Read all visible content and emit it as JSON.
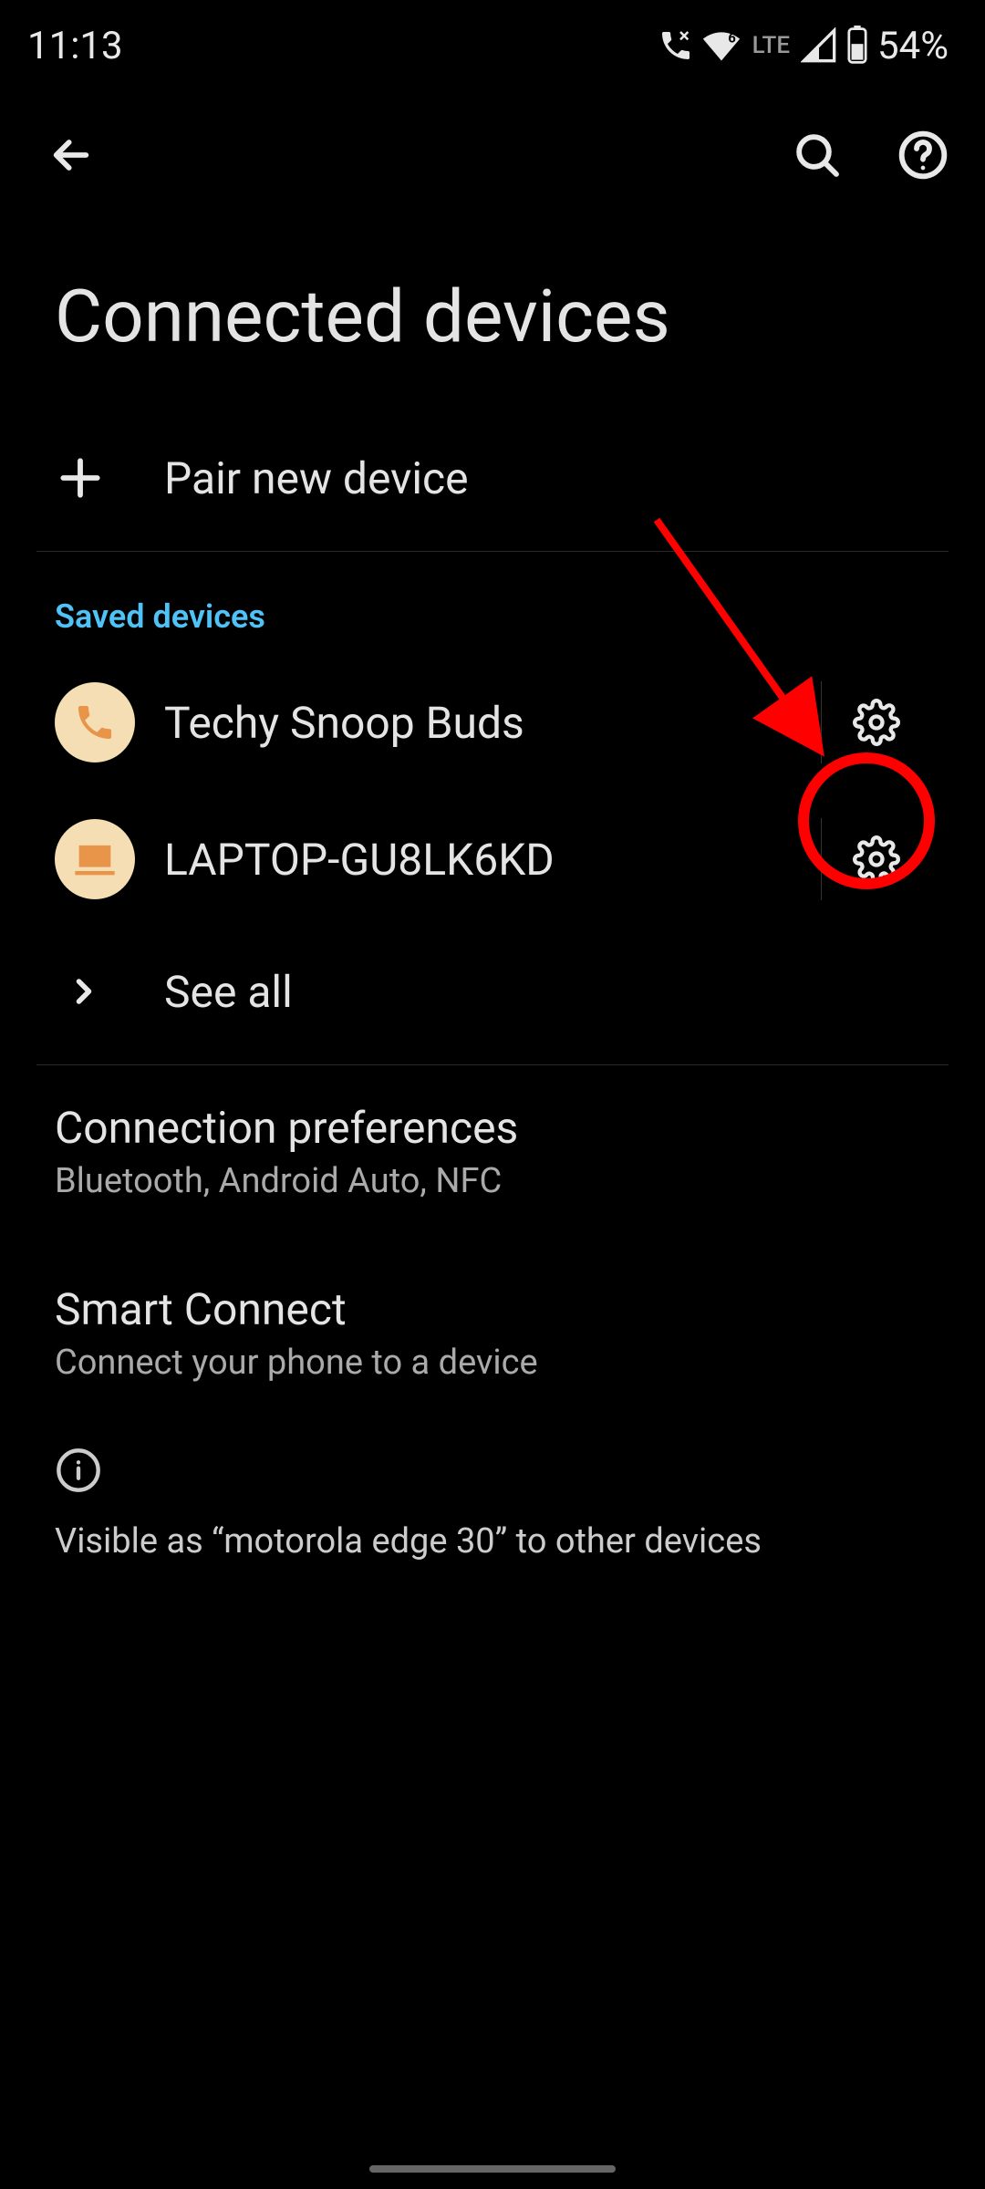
{
  "status": {
    "time": "11:13",
    "lte": "LTE",
    "battery": "54%"
  },
  "page": {
    "title": "Connected devices"
  },
  "pair": {
    "label": "Pair new device"
  },
  "saved": {
    "header": "Saved devices",
    "devices": [
      {
        "name": "Techy Snoop Buds",
        "type": "phone"
      },
      {
        "name": "LAPTOP-GU8LK6KD",
        "type": "laptop"
      }
    ],
    "see_all": "See all"
  },
  "prefs": {
    "connection": {
      "title": "Connection preferences",
      "sub": "Bluetooth, Android Auto, NFC"
    },
    "smart": {
      "title": "Smart Connect",
      "sub": "Connect your phone to a device"
    }
  },
  "visibility": {
    "text": "Visible as “motorola edge 30” to other devices"
  }
}
